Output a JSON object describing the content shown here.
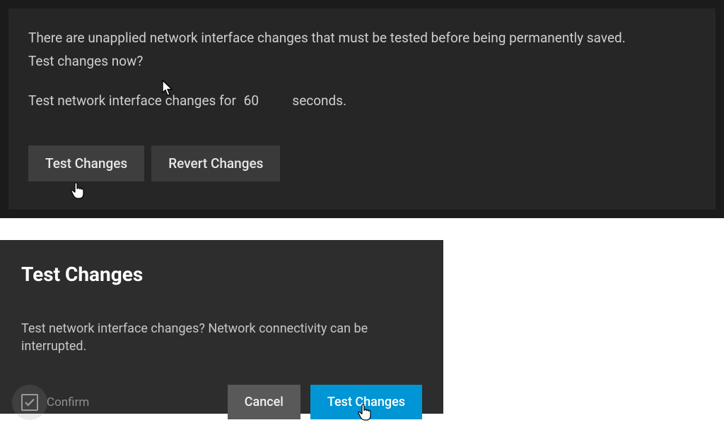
{
  "banner": {
    "line1": "There are unapplied network interface changes that must be tested before being permanently saved.",
    "line2": "Test changes now?",
    "seconds_prefix": "Test network interface changes for",
    "seconds_value": "60",
    "seconds_suffix": "seconds.",
    "test_button": "Test Changes",
    "revert_button": "Revert Changes"
  },
  "dialog": {
    "title": "Test Changes",
    "message": "Test network interface changes? Network connectivity can be interrupted.",
    "confirm_label": "Confirm",
    "confirm_checked": true,
    "cancel_button": "Cancel",
    "primary_button": "Test Changes"
  },
  "colors": {
    "primary": "#0095d5",
    "panel_bg": "#262626",
    "dialog_bg": "#2d2d2d"
  }
}
